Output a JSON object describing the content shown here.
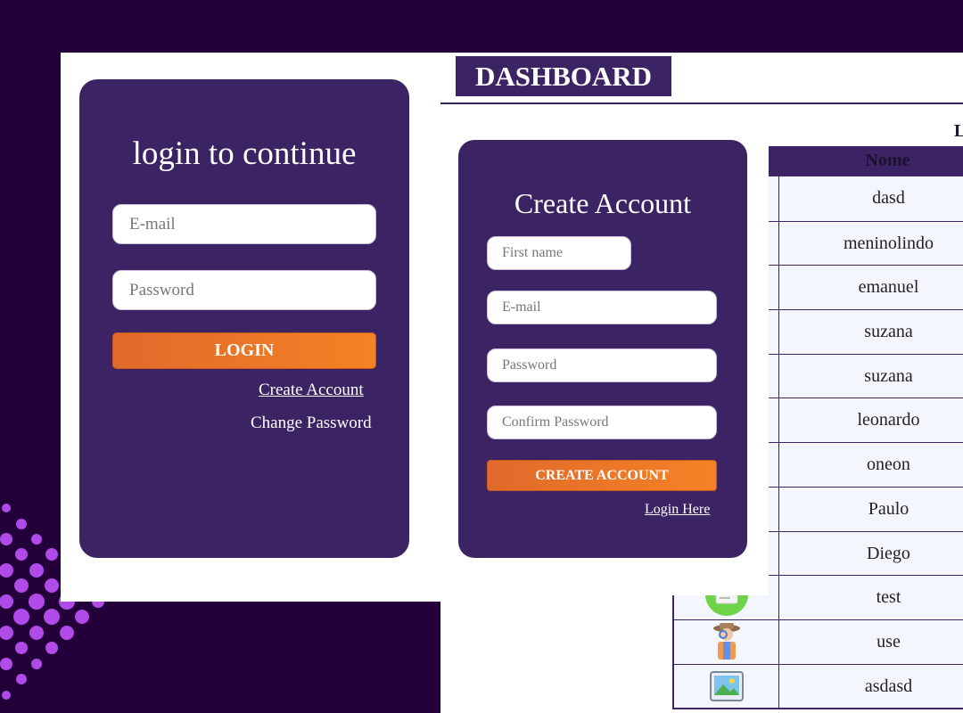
{
  "login": {
    "title": "login to continue",
    "email_placeholder": "E-mail",
    "password_placeholder": "Password",
    "button_label": "LOGIN",
    "create_account_link": "Create Account",
    "change_password_link": "Change Password"
  },
  "dashboard": {
    "title": "DASHBOARD",
    "partial_heading": "L",
    "table": {
      "column_header": "Nome",
      "rows": [
        {
          "name": "dasd"
        },
        {
          "name": "meninolindo"
        },
        {
          "name": "emanuel"
        },
        {
          "name": "suzana"
        },
        {
          "name": "suzana"
        },
        {
          "name": "leonardo"
        },
        {
          "name": "oneon"
        },
        {
          "name": "Paulo"
        },
        {
          "name": "Diego"
        },
        {
          "name": "test",
          "icon": "document-icon"
        },
        {
          "name": "use",
          "icon": "detective-icon"
        },
        {
          "name": "asdasd",
          "icon": "image-icon"
        }
      ]
    }
  },
  "create_account": {
    "title": "Create Account",
    "first_name_placeholder": "First name",
    "email_placeholder": "E-mail",
    "password_placeholder": "Password",
    "confirm_password_placeholder": "Confirm Password",
    "button_label": "CREATE ACCOUNT",
    "login_link": "Login Here"
  },
  "colors": {
    "background": "#23003a",
    "card": "#3c2363",
    "accent": "#f07a28",
    "dots": "#b04ae8"
  }
}
